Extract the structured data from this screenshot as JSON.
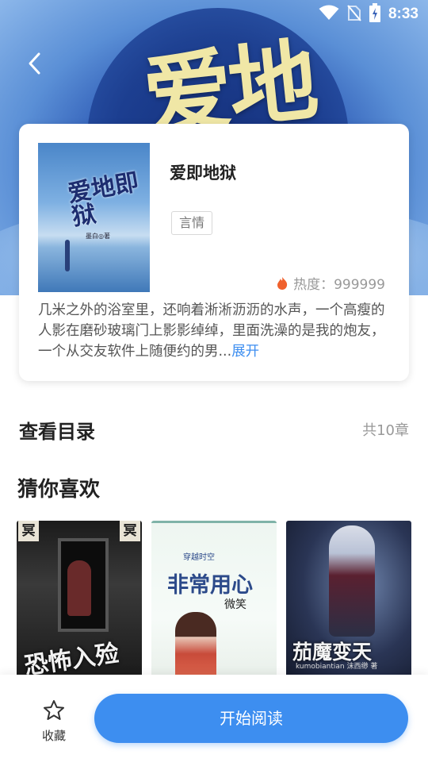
{
  "status_bar": {
    "time": "8:33",
    "icons": [
      "wifi-icon",
      "no-sim-icon",
      "battery-charging-icon"
    ]
  },
  "hero": {
    "backdrop_text": "爱地"
  },
  "book": {
    "title": "爱即地狱",
    "tag": "言情",
    "heat_label": "热度：999999",
    "description": "几米之外的浴室里，还响着淅淅沥沥的水声，一个高瘦的人影在磨砂玻璃门上影影绰绰，里面洗澡的是我的炮友，一个从交友软件上随便约的男...",
    "expand_label": "展开",
    "cover": {
      "title_text": "爱地即狱",
      "author_text": "墨白◎著"
    }
  },
  "catalog": {
    "label": "查看目录",
    "count": "共10章"
  },
  "recommend": {
    "title": "猜你喜欢",
    "items": [
      {
        "cover_text": "恐怖入殓师",
        "seal": "冥"
      },
      {
        "cover_text": "非常用心",
        "sub_text": "穿越时空",
        "author_text": "微笑"
      },
      {
        "cover_text": "茄魔变天",
        "sub_text": "kumobiantian 沫西缈 著"
      }
    ]
  },
  "bottom_bar": {
    "favorite_label": "收藏",
    "start_label": "开始阅读"
  },
  "colors": {
    "accent": "#3d8ef0",
    "heat_icon": "#f0612d"
  }
}
